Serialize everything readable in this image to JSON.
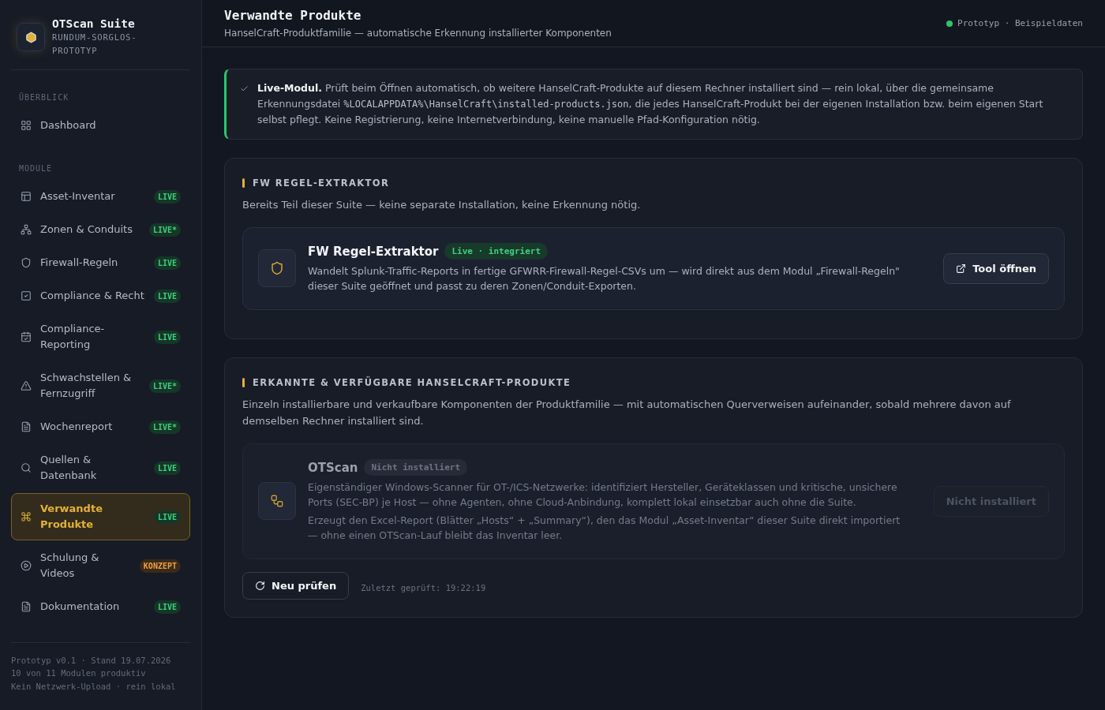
{
  "sidebar": {
    "brand": {
      "title": "OTScan Suite",
      "subtitle": "RUNDUM-SORGLOS-PROTOTYP"
    },
    "groups": [
      {
        "heading": "ÜBERBLICK",
        "items": [
          {
            "label": "Dashboard",
            "selected": false
          }
        ]
      },
      {
        "heading": "MODULE",
        "items": [
          {
            "label": "Asset-Inventar",
            "badge": {
              "text": "LIVE",
              "kind": "live"
            },
            "selected": false
          },
          {
            "label": "Zonen & Conduits",
            "badge": {
              "text": "LIVE*",
              "kind": "live"
            },
            "selected": false
          },
          {
            "label": "Firewall-Regeln",
            "badge": {
              "text": "LIVE",
              "kind": "live"
            },
            "selected": false
          },
          {
            "label": "Compliance & Recht",
            "badge": {
              "text": "LIVE",
              "kind": "live"
            },
            "selected": false
          },
          {
            "label": "Compliance-Reporting",
            "badge": {
              "text": "LIVE",
              "kind": "live"
            },
            "selected": false
          },
          {
            "label": "Schwachstellen & Fernzugriff",
            "badge": {
              "text": "LIVE*",
              "kind": "live"
            },
            "selected": false
          },
          {
            "label": "Wochenreport",
            "badge": {
              "text": "LIVE*",
              "kind": "live"
            },
            "selected": false
          },
          {
            "label": "Quellen & Datenbank",
            "badge": {
              "text": "LIVE",
              "kind": "live"
            },
            "selected": false
          },
          {
            "label": "Verwandte Produkte",
            "badge": {
              "text": "LIVE",
              "kind": "live"
            },
            "selected": true
          },
          {
            "label": "Schulung & Videos",
            "badge": {
              "text": "KONZEPT",
              "kind": "concept"
            },
            "selected": false
          },
          {
            "label": "Dokumentation",
            "badge": {
              "text": "LIVE",
              "kind": "live"
            },
            "selected": false
          }
        ]
      }
    ],
    "footer": [
      "Prototyp v0.1 · Stand 19.07.2026",
      "10 von 11 Modulen produktiv",
      "Kein Netzwerk-Upload · rein lokal"
    ]
  },
  "header": {
    "title": "Verwandte Produkte",
    "subtitle": "HanselCraft-Produktfamilie — automatische Erkennung installierter Komponenten",
    "status": "Prototyp · Beispieldaten"
  },
  "banner": {
    "parts": [
      {
        "kind": "text",
        "text": "**Live-Modul.** Prüft beim Öffnen automatisch, ob weitere HanselCraft-Produkte auf diesem Rechner installiert sind — rein lokal, über die gemeinsame Erkennungsdatei "
      },
      {
        "kind": "code",
        "text": "%LOCALAPPDATA%\\HanselCraft\\installed-products.json"
      },
      {
        "kind": "text",
        "text": ", die jedes HanselCraft-Produkt bei der eigenen Installation bzw. beim eigenen Start selbst pflegt. Keine Registrierung, keine Internetverbindung, keine manuelle Pfad-Konfiguration nötig."
      }
    ]
  },
  "sections": [
    {
      "title": "FW REGEL-EXTRAKTOR",
      "description": "Bereits Teil dieser Suite — keine separate Installation, keine Erkennung nötig.",
      "products": [
        {
          "kind": "integrated",
          "name": "FW Regel-Extraktor",
          "installed": true,
          "badge": "Live · integriert",
          "paragraphs": [
            "Wandelt Splunk-Traffic-Reports in fertige GFWRR-Firewall-Regel-CSVs um — wird direkt aus dem Modul „Firewall-Regeln\" dieser Suite geöffnet und passt zu deren Zonen/Conduit-Exporten."
          ],
          "button": {
            "label": "Tool öffnen",
            "disabled": false
          }
        }
      ]
    },
    {
      "title": "ERKANNTE & VERFÜGBARE HANSELCRAFT-PRODUKTE",
      "description": "Einzeln installierbare und verkaufbare Komponenten der Produktfamilie — mit automatischen Querverweisen aufeinander, sobald mehrere davon auf demselben Rechner installiert sind.",
      "products": [
        {
          "kind": "standalone",
          "name": "OTScan",
          "installed": false,
          "badge": "Nicht installiert",
          "paragraphs": [
            "Eigenständiger Windows-Scanner für OT-/ICS-Netzwerke: identifiziert Hersteller, Geräteklassen und kritische, unsichere Ports (SEC-BP) je Host — ohne Agenten, ohne Cloud-Anbindung, komplett lokal einsetzbar auch ohne die Suite.",
            "Erzeugt den Excel-Report (Blätter „Hosts“ + „Summary“), den das Modul „Asset-Inventar“ dieser Suite direkt importiert — ohne einen OTScan-Lauf bleibt das Inventar leer."
          ],
          "button": {
            "label": "Nicht installiert",
            "disabled": true
          }
        }
      ],
      "recheck": {
        "button": "Neu prüfen",
        "last_checked": "Zuletzt geprüft: 19:22:19"
      }
    }
  ]
}
